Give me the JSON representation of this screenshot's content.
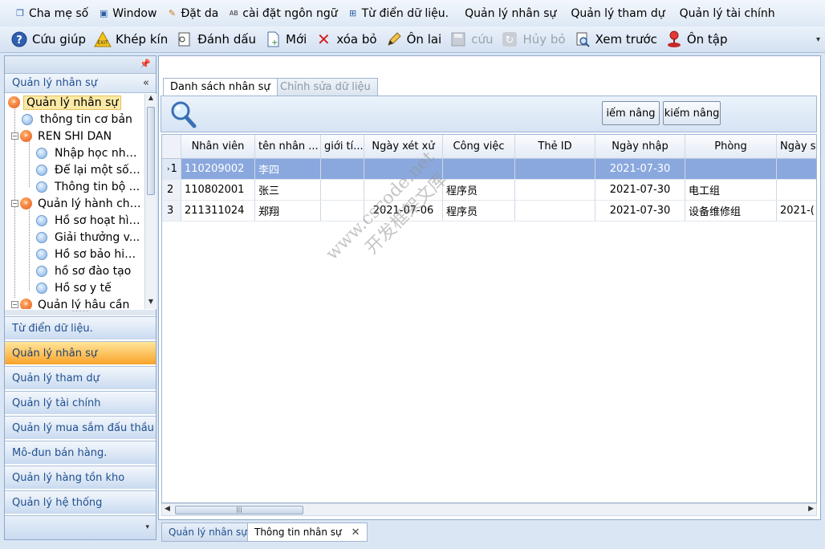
{
  "menubar": {
    "items": [
      {
        "label": "Cha mẹ số",
        "icon": "window-cascade-icon"
      },
      {
        "label": "Window",
        "icon": "window-icon"
      },
      {
        "label": "Đặt da",
        "icon": "skin-icon"
      },
      {
        "label": "cài đặt ngôn ngữ",
        "icon": "language-icon"
      },
      {
        "label": "Từ điển dữ liệu.",
        "icon": "dictionary-icon"
      },
      {
        "label": "Quản lý nhân sự",
        "icon": ""
      },
      {
        "label": "Quản lý tham dự",
        "icon": ""
      },
      {
        "label": "Quản lý tài chính",
        "icon": ""
      }
    ]
  },
  "toolbar": {
    "help": "Cứu giúp",
    "close": "Khép kín",
    "mark": "Đánh dấu",
    "new": "Mới",
    "delete": "xóa bỏ",
    "edit": "Ôn lai",
    "save": "cứu",
    "cancel": "Hủy bỏ",
    "preview": "Xem trước",
    "review": "Ôn tập"
  },
  "leftpanel": {
    "title": "Quản lý nhân sự",
    "tree": [
      {
        "label": "Quản lý nhân sự",
        "level": 0,
        "type": "group",
        "selected": true
      },
      {
        "label": "thông tin cơ bản",
        "level": 1,
        "type": "leaf"
      },
      {
        "label": "REN SHI DAN",
        "level": 1,
        "type": "group"
      },
      {
        "label": "Nhập học nhâ...",
        "level": 2,
        "type": "leaf"
      },
      {
        "label": "Để lại một số ...",
        "level": 2,
        "type": "leaf"
      },
      {
        "label": "Thông tin bộ ...",
        "level": 2,
        "type": "leaf"
      },
      {
        "label": "Quản lý hành chính",
        "level": 1,
        "type": "group"
      },
      {
        "label": "Hồ sơ hoạt hình",
        "level": 2,
        "type": "leaf"
      },
      {
        "label": "Giải thưởng v...",
        "level": 2,
        "type": "leaf"
      },
      {
        "label": "Hồ sơ bảo hiểm",
        "level": 2,
        "type": "leaf"
      },
      {
        "label": "hồ sơ đào tạo",
        "level": 2,
        "type": "leaf"
      },
      {
        "label": "Hồ sơ y tế",
        "level": 2,
        "type": "leaf"
      },
      {
        "label": "Quản lý hậu cần",
        "level": 1,
        "type": "group"
      }
    ],
    "nav": [
      {
        "label": "Từ điển dữ liệu.",
        "active": false
      },
      {
        "label": "Quản lý nhân sự",
        "active": true
      },
      {
        "label": "Quản lý tham dự",
        "active": false
      },
      {
        "label": "Quản lý tài chính",
        "active": false
      },
      {
        "label": "Quản lý mua sắm đấu thầu",
        "active": false
      },
      {
        "label": "Mô-đun bán hàng.",
        "active": false
      },
      {
        "label": "Quản lý hàng tồn kho",
        "active": false
      },
      {
        "label": "Quản lý hệ thống",
        "active": false
      }
    ]
  },
  "content": {
    "tabs": [
      "Danh sách nhân sự",
      "Chỉnh sửa dữ liệu"
    ],
    "search_btn_1": "iếm nâng",
    "search_btn_2": "kiếm nâng",
    "columns": [
      "Nhân viên",
      "tên nhân ...",
      "giới tí...",
      "Ngày xét xử",
      "Công việc",
      "Thẻ ID",
      "Ngày nhập",
      "Phòng",
      "Ngày s"
    ],
    "rows": [
      {
        "num": "1",
        "cells": [
          "110209002",
          "李四",
          "",
          "",
          "",
          "",
          "2021-07-30",
          "",
          ""
        ]
      },
      {
        "num": "2",
        "cells": [
          "110802001",
          "张三",
          "",
          "",
          "程序员",
          "",
          "2021-07-30",
          "电工组",
          ""
        ]
      },
      {
        "num": "3",
        "cells": [
          "211311024",
          "郑翔",
          "",
          "2021-07-06",
          "程序员",
          "",
          "2021-07-30",
          "设备维修组",
          "2021-("
        ]
      }
    ]
  },
  "bottomtabs": {
    "tab1": "Quản lý nhân sự",
    "tab2": "Thông tin nhân sự"
  },
  "watermark": {
    "line1": "www.cscode.net",
    "line2": "开发框架文库"
  }
}
